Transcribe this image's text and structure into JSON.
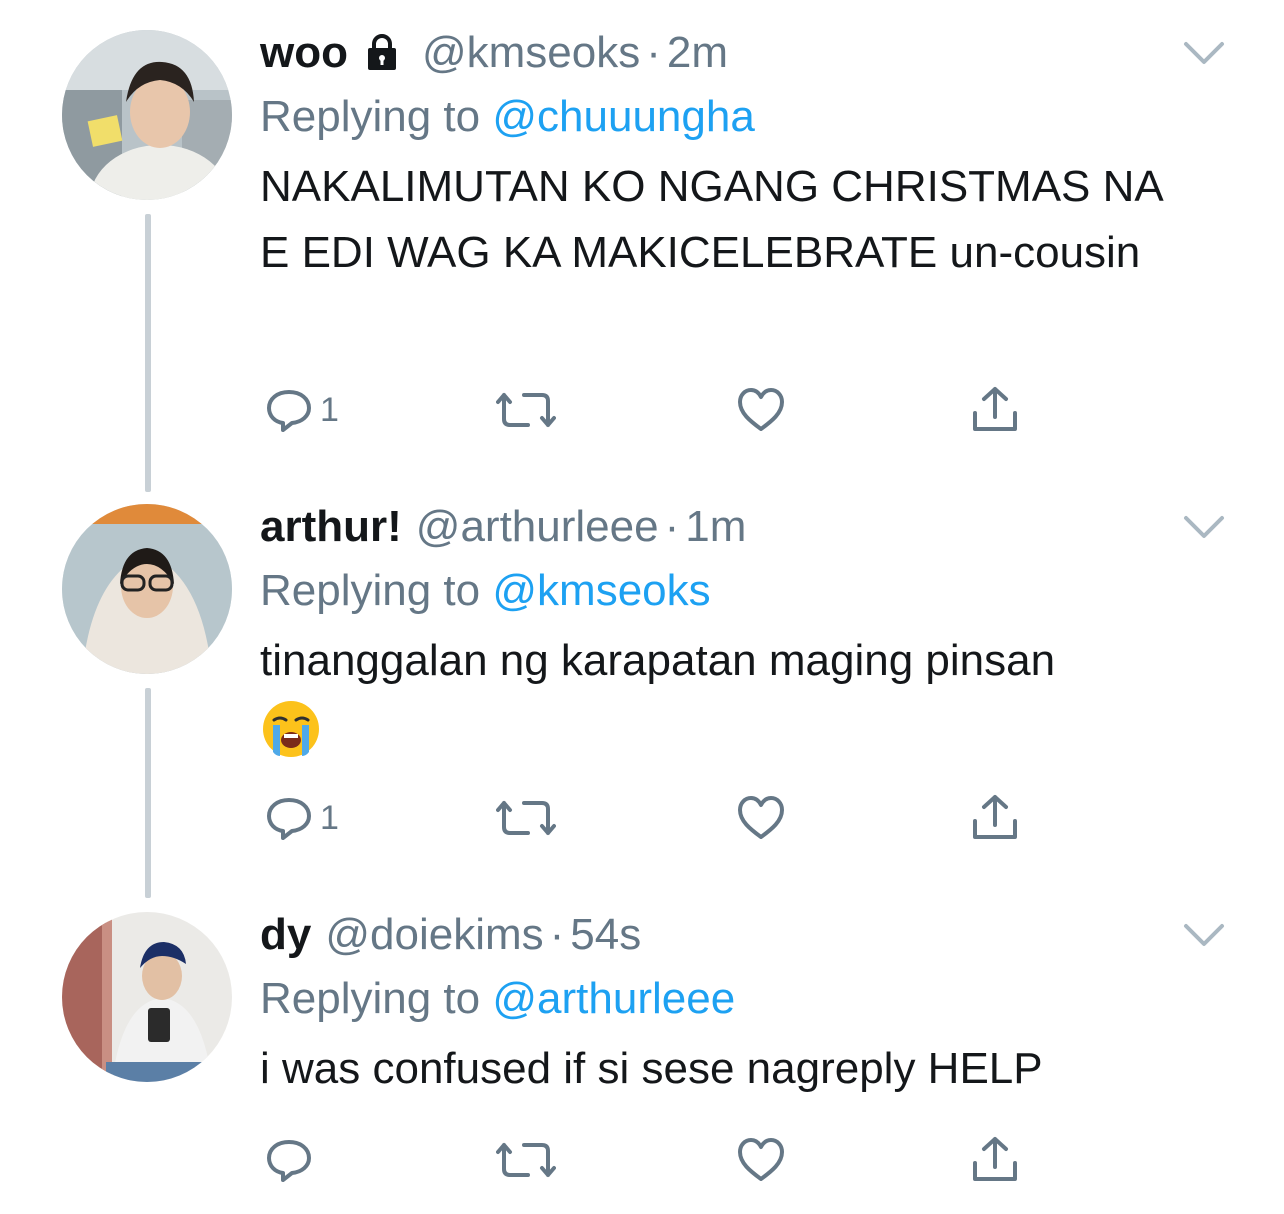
{
  "colors": {
    "text": "#14171a",
    "secondary": "#657786",
    "link": "#1da1f2",
    "thread_line": "#c8d0d6",
    "background": "#ffffff"
  },
  "tweets": [
    {
      "display_name": "woo",
      "locked": true,
      "handle": "@kmseoks",
      "separator": "·",
      "time": "2m",
      "replying_prefix": "Replying to",
      "replying_to": "@chuuungha",
      "text": "NAKALIMUTAN KO NGANG CHRISTMAS NA E EDI WAG KA MAKICELEBRATE un-cousin",
      "reply_count": "1"
    },
    {
      "display_name": "arthur!",
      "handle": "@arthurleee",
      "separator": "·",
      "time": "1m",
      "replying_prefix": "Replying to",
      "replying_to": "@kmseoks",
      "text": "tinanggalan ng karapatan maging pinsan",
      "emoji": "loudly-crying-face",
      "reply_count": "1"
    },
    {
      "display_name": "dy",
      "handle": "@doiekims",
      "separator": "·",
      "time": "54s",
      "replying_prefix": "Replying to",
      "replying_to": "@arthurleee",
      "text": "i was confused if si sese nagreply HELP",
      "reply_count": ""
    }
  ],
  "icons": {
    "reply": "reply-icon",
    "retweet": "retweet-icon",
    "like": "like-heart-icon",
    "share": "share-icon",
    "menu": "chevron-down-icon",
    "lock": "lock-icon"
  }
}
